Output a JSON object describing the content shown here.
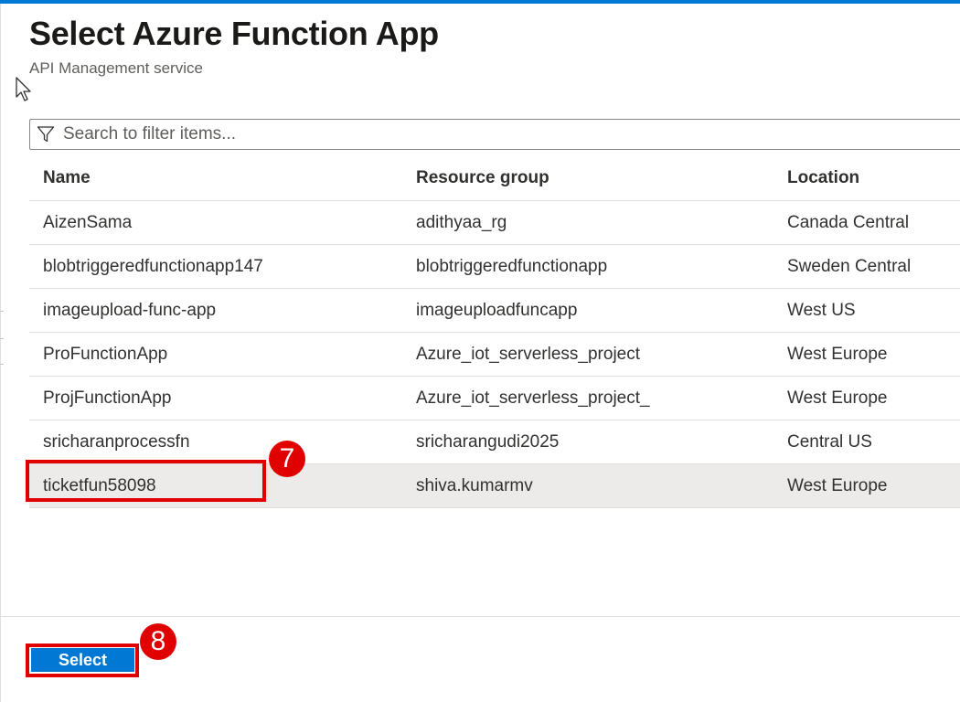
{
  "header": {
    "title": "Select Azure Function App",
    "subtitle": "API Management service"
  },
  "search": {
    "placeholder": "Search to filter items...",
    "value": "",
    "icon": "filter-icon"
  },
  "table": {
    "columns": [
      "Name",
      "Resource group",
      "Location"
    ],
    "rows": [
      {
        "name": "AizenSama",
        "resource_group": "adithyaa_rg",
        "location": "Canada Central"
      },
      {
        "name": "blobtriggeredfunctionapp147",
        "resource_group": "blobtriggeredfunctionapp",
        "location": "Sweden Central"
      },
      {
        "name": "imageupload-func-app",
        "resource_group": "imageuploadfuncapp",
        "location": "West US"
      },
      {
        "name": "ProFunctionApp",
        "resource_group": "Azure_iot_serverless_project",
        "location": "West Europe"
      },
      {
        "name": "ProjFunctionApp",
        "resource_group": "Azure_iot_serverless_project_",
        "location": "West Europe"
      },
      {
        "name": "sricharanprocessfn",
        "resource_group": "sricharangudi2025",
        "location": "Central US"
      },
      {
        "name": "ticketfun58098",
        "resource_group": "shiva.kumarmv",
        "location": "West Europe"
      }
    ],
    "selected_row": 6
  },
  "annotations": {
    "step_row": "7",
    "step_button": "8",
    "color": "#e00000"
  },
  "footer": {
    "select_label": "Select"
  },
  "colors": {
    "accent": "#0078d4",
    "selected_row_bg": "#edebe9"
  }
}
